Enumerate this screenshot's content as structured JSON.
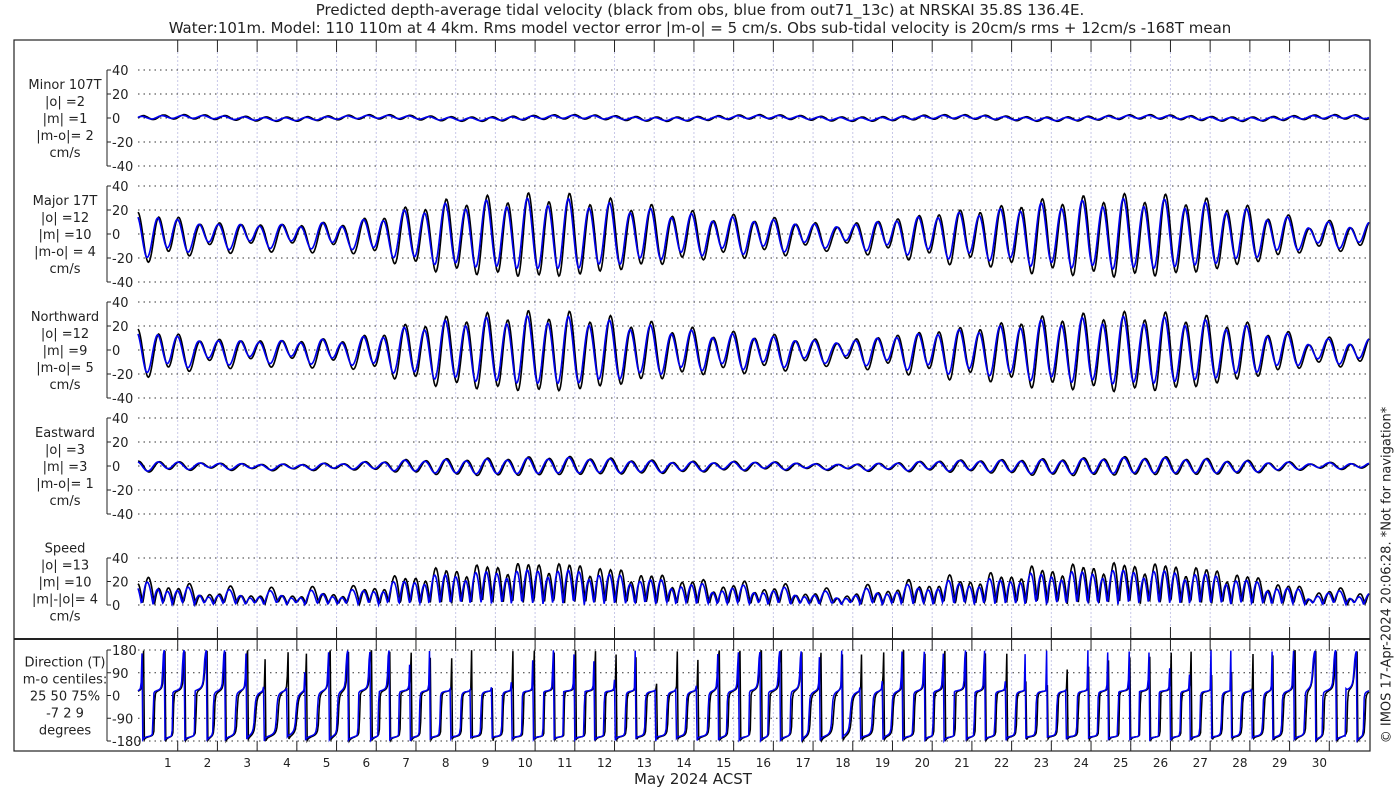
{
  "title_line1": "Predicted depth-average tidal velocity (black from obs, blue from out71_13c) at NRSKAI 35.8S 136.4E.",
  "title_line2": "Water:101m. Model: 110 110m at 4 4km. Rms model vector error |m-o| = 5 cm/s. Obs sub-tidal velocity is 20cm/s rms + 12cm/s -168T mean",
  "watermark": "© IMOS 17-Apr-2024 20:06:28. *Not for navigation*",
  "colors": {
    "obs": "#000000",
    "model": "#0000ee",
    "grid": "#c8c8e8"
  },
  "chart_data": {
    "type": "line",
    "xlabel": "May 2024 ACST",
    "x_ticks": [
      "1",
      "2",
      "3",
      "4",
      "5",
      "6",
      "7",
      "8",
      "9",
      "10",
      "11",
      "12",
      "13",
      "14",
      "15",
      "16",
      "17",
      "18",
      "19",
      "20",
      "21",
      "22",
      "23",
      "24",
      "25",
      "26",
      "27",
      "28",
      "29",
      "30"
    ],
    "xlim_days": [
      0,
      31
    ],
    "series_legend": [
      "obs (black)",
      "model (blue)"
    ],
    "daily_major_amplitude_obs_cms": [
      18,
      11,
      10,
      9,
      10,
      11,
      20,
      27,
      30,
      32,
      33,
      30,
      25,
      20,
      16,
      15,
      12,
      8,
      12,
      16,
      20,
      22,
      28,
      30,
      32,
      32,
      30,
      25,
      18,
      10
    ],
    "model_to_obs_ratio": 0.85,
    "panels": [
      {
        "id": "minor",
        "label": [
          "Minor 107T",
          "|o| =2",
          "|m| =1",
          "|m-o|= 2",
          "cm/s"
        ],
        "yticks": [
          "40",
          "20",
          "0",
          "-20",
          "-40"
        ],
        "ylim": [
          -40,
          40
        ],
        "scale": 0.07
      },
      {
        "id": "major",
        "label": [
          "Major 17T",
          "|o| =12",
          "|m| =10",
          "|m-o| = 4",
          "cm/s"
        ],
        "yticks": [
          "40",
          "20",
          "0",
          "-20",
          "-40"
        ],
        "ylim": [
          -40,
          40
        ],
        "scale": 1.0
      },
      {
        "id": "north",
        "label": [
          "Northward",
          "|o| =12",
          "|m| =9",
          "|m-o|= 5",
          "cm/s"
        ],
        "yticks": [
          "40",
          "20",
          "0",
          "-20",
          "-40"
        ],
        "ylim": [
          -40,
          40
        ],
        "scale": 0.96
      },
      {
        "id": "east",
        "label": [
          "Eastward",
          "|o| =3",
          "|m| =3",
          "|m-o|= 1",
          "cm/s"
        ],
        "yticks": [
          "40",
          "20",
          "0",
          "-20",
          "-40"
        ],
        "ylim": [
          -40,
          40
        ],
        "scale": 0.22
      },
      {
        "id": "speed",
        "label": [
          "Speed",
          "|o| =13",
          "|m| =10",
          "|m|-|o|= 4",
          "cm/s"
        ],
        "yticks": [
          "40",
          "20",
          "0"
        ],
        "ylim": [
          0,
          40
        ],
        "scale": 1.0
      },
      {
        "id": "direction",
        "label": [
          "Direction (T)",
          "m-o centiles:",
          "25  50  75%",
          "-7  2  9",
          "degrees"
        ],
        "yticks": [
          "180",
          "90",
          "0",
          "-90",
          "-180"
        ],
        "ylim": [
          -180,
          180
        ],
        "scale": 1.0
      }
    ]
  }
}
